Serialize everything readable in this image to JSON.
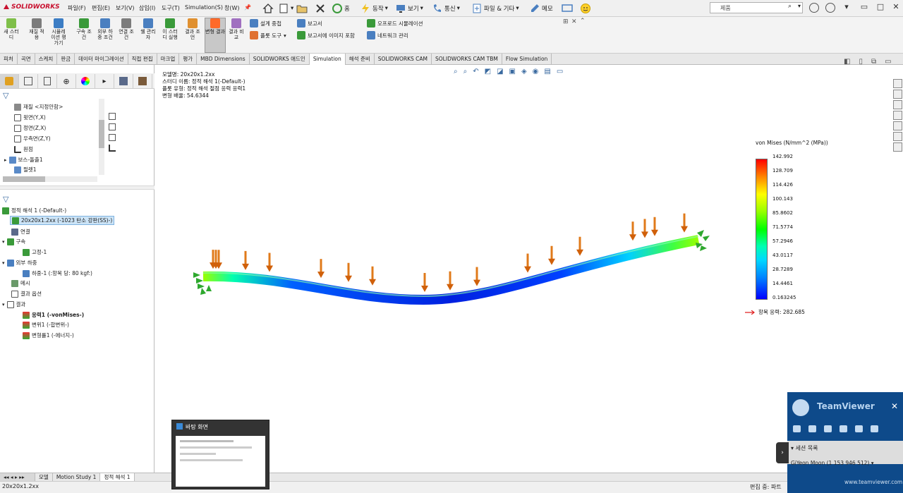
{
  "app": {
    "logo": "SOLIDWORKS"
  },
  "menu": [
    "파일(F)",
    "편집(E)",
    "보기(V)",
    "삽입(I)",
    "도구(T)",
    "Simulation(S)",
    "창(W)"
  ],
  "quick_tools": {
    "home": "홈",
    "motion": "동작",
    "view": "보기",
    "comm": "통신",
    "file_etc": "파일 & 기타",
    "memo": "메모"
  },
  "search": {
    "placeholder": "제품"
  },
  "command_manager": {
    "large": [
      {
        "label": "새 스터디"
      },
      {
        "label": "재질 적용"
      },
      {
        "label": "시뮬레이션 평가기"
      },
      {
        "label": "구속 조건"
      },
      {
        "label": "외부 하중 조건"
      },
      {
        "label": "연결 조건"
      },
      {
        "label": "쉘 관리자"
      },
      {
        "label": "이 스터디 실행"
      },
      {
        "label": "결과 조언"
      },
      {
        "label": "변형 결과"
      },
      {
        "label": "결과 비교"
      }
    ],
    "small": {
      "design_check": "설계 중첩",
      "plot_tools": "플롯 도구",
      "report": "보고서",
      "image_in_report": "보고서에 이미지 포함",
      "offload_sim": "오프로드 시뮬레이션",
      "network_manage": "네트워크 관리"
    }
  },
  "tabs": [
    "피처",
    "곡면",
    "스케치",
    "판금",
    "데이터 마이그레이션",
    "직접 편집",
    "마크업",
    "평가",
    "MBD Dimensions",
    "SOLIDWORKS 애드인",
    "Simulation",
    "해석 준비",
    "SOLIDWORKS CAM",
    "SOLIDWORKS CAM TBM",
    "Flow Simulation"
  ],
  "active_tab": "Simulation",
  "feature_tree": [
    {
      "label": "재질 <지정안함>"
    },
    {
      "label": "윗면(Y,X)"
    },
    {
      "label": "정면(Z,X)"
    },
    {
      "label": "우측면(Z,Y)"
    },
    {
      "label": "원점"
    },
    {
      "label": "보스-돌출1"
    },
    {
      "label": "필렛1"
    }
  ],
  "sim_tree": [
    {
      "label": "정적 해석 1 (-Default-)"
    },
    {
      "label": "20x20x1.2xx (-1023 탄소 강판(SS)-)"
    },
    {
      "label": "연결"
    },
    {
      "label": "구속"
    },
    {
      "label": "고정-1"
    },
    {
      "label": "외부 하중"
    },
    {
      "label": "하중-1 (:항목 당: 80 kgf:)"
    },
    {
      "label": "메시"
    },
    {
      "label": "결과 옵션"
    },
    {
      "label": "결과"
    },
    {
      "label": "응력1 (-vonMises-)"
    },
    {
      "label": "변위1 (-합변위-)"
    },
    {
      "label": "변형률1 (-에너지-)"
    }
  ],
  "viewport_info": [
    "모델명: 20x20x1.2xx",
    "스터디 이름: 정적 해석 1(-Default-)",
    "플롯 유형: 정적 해석 절점 응력 응력1",
    "변형 배율: 54.6344"
  ],
  "legend": {
    "title": "von Mises (N/mm^2 (MPa))",
    "ticks": [
      "142.992",
      "128.709",
      "114.426",
      "100.143",
      "85.8602",
      "71.5774",
      "57.2946",
      "43.0117",
      "28.7289",
      "14.4461",
      "0.163245"
    ],
    "yield": "항복 응력: 282.685",
    "yield_color": "#e02020"
  },
  "bottom_tabs": [
    "모델",
    "Motion Study 1",
    "정적 해석 1"
  ],
  "active_bottom_tab": "정적 해석 1",
  "status": {
    "left": "20x20x1.2xx",
    "right": "편집 중: 파트"
  },
  "thumbnail": {
    "title": "바탕 화면"
  },
  "teamviewer": {
    "title": "TeamViewer",
    "session_list": "세션 목록",
    "user": "GiYeon Moon (1 153 946 512)",
    "url": "www.teamviewer.com"
  }
}
